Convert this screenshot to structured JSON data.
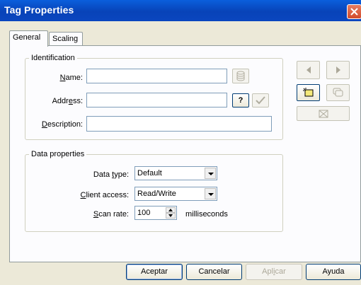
{
  "window": {
    "title": "Tag Properties"
  },
  "tabs": [
    {
      "label": "General",
      "active": true
    },
    {
      "label": "Scaling",
      "active": false
    }
  ],
  "identification": {
    "legend": "Identification",
    "name_label_pre": "",
    "name_label_u": "N",
    "name_label_post": "ame:",
    "name_value": "",
    "address_label_pre": "Addr",
    "address_label_u": "e",
    "address_label_post": "ss:",
    "address_value": "",
    "address_help": "?",
    "description_label_pre": "",
    "description_label_u": "D",
    "description_label_post": "escription:",
    "description_value": ""
  },
  "data_properties": {
    "legend": "Data properties",
    "data_type_label_pre": "Data ",
    "data_type_label_u": "t",
    "data_type_label_post": "ype:",
    "data_type_value": "Default",
    "client_access_label_pre": "",
    "client_access_label_u": "C",
    "client_access_label_post": "lient access:",
    "client_access_value": "Read/Write",
    "scan_rate_label_pre": "",
    "scan_rate_label_u": "S",
    "scan_rate_label_post": "can rate:",
    "scan_rate_value": "100",
    "scan_rate_unit": "milliseconds"
  },
  "buttons": {
    "ok": "Aceptar",
    "cancel": "Cancelar",
    "apply_pre": "Apl",
    "apply_u": "i",
    "apply_post": "car",
    "help": "Ayuda"
  },
  "colors": {
    "titlebar": "#0a46bf",
    "close": "#d24b2b",
    "dialog_bg": "#ece9d8"
  }
}
